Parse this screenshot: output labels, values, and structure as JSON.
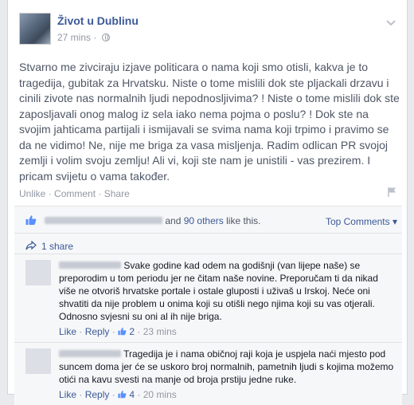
{
  "post": {
    "page_name": "Život u Dublinu",
    "timestamp": "27 mins",
    "meta_separator": "·",
    "text": "Stvarno me zivciraju izjave politicara o nama koji smo otisli, kakva je to tragedija, gubitak za Hrvatsku. Niste o tome mislili dok ste pljackali drzavu i cinili zivote nas normalnih ljudi nepodnosljivima? ! Niste o tome mislili dok ste zaposljavali onog malog iz sela iako nema pojma o poslu? ! Dok ste na svojim jahticama partijali i ismijavali se svima nama koji trpimo i pravimo se da ne vidimo! Ne, nije me briga za vasa misljenja. Radim odlican PR svojoj zemlji i volim svoju zemlju! Ali vi, koji ste nam je unistili - vas prezirem. I pricam svijetu o vama također.",
    "actions": {
      "unlike": "Unlike",
      "comment": "Comment",
      "share": "Share",
      "sep": "·"
    }
  },
  "ufi": {
    "likes": {
      "and_text": "and",
      "others_link": "90 others",
      "suffix": "like this."
    },
    "top_comments": "Top Comments ▾",
    "shares": "1 share",
    "comments": [
      {
        "text": "Svake godine kad odem na godišnji (van lijepe naše) se preporodim u tom periodu jer ne čitam naše novine. Preporučam ti da nikad više ne otvoriš hrvatske portale i ostale gluposti i uživaš u Irskoj. Neće oni shvatiti da nije problem u onima koji su otišli nego njima koji su vas otjerali. Odnosno svjesni su oni al ih nije briga.",
        "like": "Like",
        "reply": "Reply",
        "like_count": "2",
        "time": "23 mins"
      },
      {
        "text": "Tragedija je i nama običnoj raji koja je uspjela naći mjesto pod suncem doma jer će se uskoro broj normalnih, pametnih ljudi s kojima možemo otići na kavu svesti na manje od broja prstiju jedne ruke.",
        "like": "Like",
        "reply": "Reply",
        "like_count": "4",
        "time": "20 mins"
      }
    ]
  },
  "colors": {
    "link": "#3b5998",
    "muted": "#9197a3",
    "body": "#4e5665",
    "background": "#e9eaed"
  },
  "icons": [
    "chevron-down-icon",
    "globe-icon",
    "flag-icon",
    "thumbs-up-icon",
    "share-arrow-icon"
  ]
}
